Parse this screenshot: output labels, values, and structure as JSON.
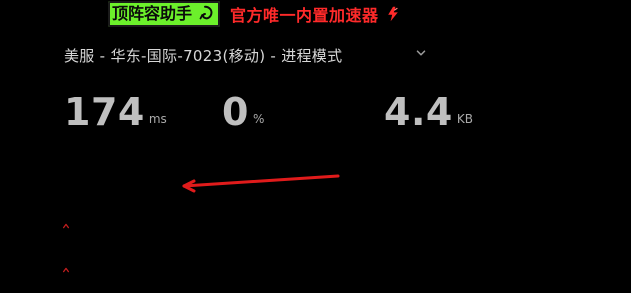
{
  "header": {
    "brand_text": "顶阵容助手",
    "tagline": "官方唯一内置加速器"
  },
  "route": {
    "text": "美服 - 华东-国际-7023(移动) - 进程模式"
  },
  "metrics": {
    "ping": {
      "value": "174",
      "unit": "ms"
    },
    "loss": {
      "value": "0",
      "unit": "%"
    },
    "speed": {
      "value": "4.4",
      "unit": "KB"
    }
  },
  "colors": {
    "background": "#000000",
    "brand_green": "#6cf02b",
    "accent_red": "#ff2a2a",
    "text_primary": "#d7d7d7",
    "metric_text": "#bfbfbf"
  },
  "icons": {
    "brand_mark": "swirl-icon",
    "tagline_icon": "bolt-icon",
    "route_dropdown": "chevron-down-icon",
    "annotation": "red-arrow-icon",
    "markers": "caret-up-icon"
  }
}
